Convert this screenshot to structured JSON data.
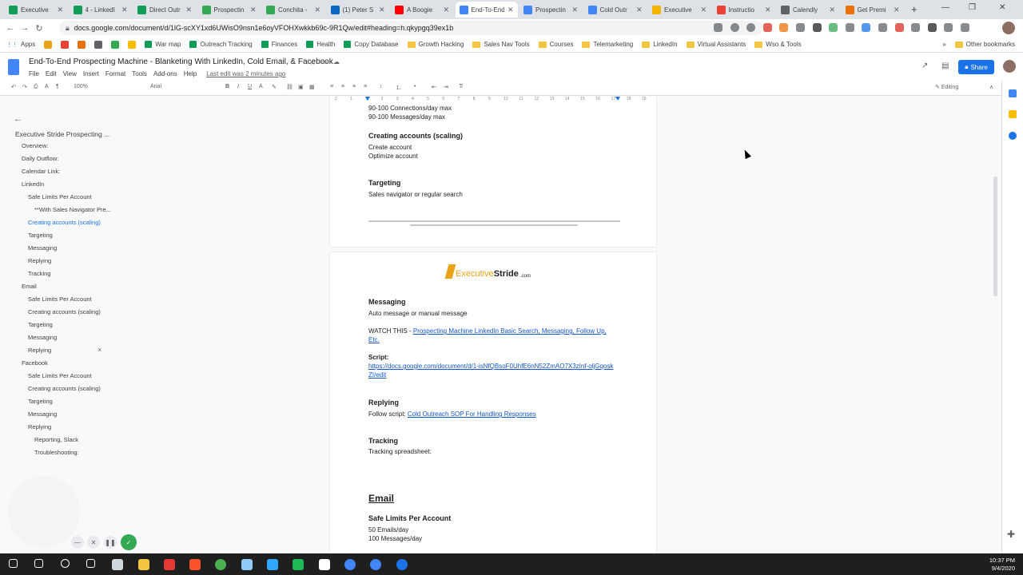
{
  "browser": {
    "tabs": [
      {
        "title": "Executive",
        "color": "#0f9d58"
      },
      {
        "title": "4 - LinkedI",
        "color": "#0f9d58"
      },
      {
        "title": "Direct Outr",
        "color": "#0f9d58"
      },
      {
        "title": "Prospectin",
        "color": "#34a853"
      },
      {
        "title": "Conchita -",
        "color": "#34a853"
      },
      {
        "title": "(1) Peter S",
        "color": "#0a66c2"
      },
      {
        "title": "A Boogie",
        "color": "#ff0000"
      },
      {
        "title": "End-To-End",
        "color": "#4285f4"
      },
      {
        "title": "Prospectin",
        "color": "#4285f4"
      },
      {
        "title": "Cold Outr",
        "color": "#4285f4"
      },
      {
        "title": "Executive",
        "color": "#f4b400"
      },
      {
        "title": "Instructio",
        "color": "#ea4335"
      },
      {
        "title": "Calendly",
        "color": "#5f6368"
      },
      {
        "title": "Get Premi",
        "color": "#e8710a"
      }
    ],
    "active_tab": 7,
    "url": "docs.google.com/document/d/1lG-scXY1xd6UWisO9nsn1e6oyVFOHXwkkb69c-9R1Qw/edit#heading=h.qkypgq39ex1b",
    "bookmarks": [
      {
        "label": "Apps",
        "kind": "apps"
      },
      {
        "label": "War map",
        "kind": "sheet"
      },
      {
        "label": "Outreach Tracking",
        "kind": "sheet"
      },
      {
        "label": "Finances",
        "kind": "sheet"
      },
      {
        "label": "Health",
        "kind": "sheet"
      },
      {
        "label": "Copy Database",
        "kind": "sheet"
      },
      {
        "label": "Growth Hacking",
        "kind": "folder"
      },
      {
        "label": "Sales Nav Tools",
        "kind": "folder"
      },
      {
        "label": "Courses",
        "kind": "folder"
      },
      {
        "label": "Telemarketing",
        "kind": "folder"
      },
      {
        "label": "LinkedIn",
        "kind": "folder"
      },
      {
        "label": "Virtual Assistants",
        "kind": "folder"
      },
      {
        "label": "Wso & Tools",
        "kind": "folder"
      }
    ],
    "other_bookmarks": "Other bookmarks",
    "more_glyph": "»"
  },
  "doc": {
    "title": "End-To-End Prospecting Machine - Blanketing With LinkedIn, Cold Email, & Facebook",
    "menus": [
      "File",
      "Edit",
      "View",
      "Insert",
      "Format",
      "Tools",
      "Add-ons",
      "Help"
    ],
    "last_edit": "Last edit was 2 minutes ago",
    "share": "Share",
    "zoom": "100%",
    "font": "Arial",
    "mode": "Editing"
  },
  "outline": {
    "title": "Executive Stride Prospecting ...",
    "items": [
      {
        "label": "Overview:",
        "level": 1,
        "active": false
      },
      {
        "label": "Daily Outflow:",
        "level": 1,
        "active": false
      },
      {
        "label": "Calendar Link:",
        "level": 1,
        "active": false
      },
      {
        "label": "LinkedIn",
        "level": 1,
        "active": false
      },
      {
        "label": "Safe Limits Per Account",
        "level": 2,
        "active": false
      },
      {
        "label": "**With Sales Navigator Pre...",
        "level": 3,
        "active": false
      },
      {
        "label": "Creating accounts (scaling)",
        "level": 2,
        "active": true
      },
      {
        "label": "Targeting",
        "level": 2,
        "active": false
      },
      {
        "label": "Messaging",
        "level": 2,
        "active": false
      },
      {
        "label": "Replying",
        "level": 2,
        "active": false
      },
      {
        "label": "Tracking",
        "level": 2,
        "active": false
      },
      {
        "label": "Email",
        "level": 1,
        "active": false
      },
      {
        "label": "Safe Limits Per Account",
        "level": 2,
        "active": false
      },
      {
        "label": "Creating accounts (scaling)",
        "level": 2,
        "active": false
      },
      {
        "label": "Targeting",
        "level": 2,
        "active": false
      },
      {
        "label": "Messaging",
        "level": 2,
        "active": false
      },
      {
        "label": "Replying",
        "level": 2,
        "active": false
      },
      {
        "label": "Facebook",
        "level": 1,
        "active": false
      },
      {
        "label": "Safe Limits Per Account",
        "level": 2,
        "active": false
      },
      {
        "label": "Creating accounts (scaling)",
        "level": 2,
        "active": false
      },
      {
        "label": "Targeting",
        "level": 2,
        "active": false
      },
      {
        "label": "Messaging",
        "level": 2,
        "active": false
      },
      {
        "label": "Replying",
        "level": 2,
        "active": false
      },
      {
        "label": "Reporting, Slack",
        "level": 3,
        "active": false
      },
      {
        "label": "Troubleshooting:",
        "level": 3,
        "active": false
      }
    ],
    "remove_glyph": "×"
  },
  "ruler": {
    "ticks": [
      "2",
      "1",
      "1",
      "2",
      "3",
      "4",
      "5",
      "6",
      "7",
      "8",
      "9",
      "10",
      "11",
      "12",
      "13",
      "14",
      "15",
      "16",
      "17",
      "18",
      "19"
    ]
  },
  "page1": {
    "connections": "90-100 Connections/day max",
    "messages": "90-100 Messages/day max",
    "h_creating": "Creating accounts (scaling)",
    "create": "Create account",
    "optimize": "Optimize account",
    "h_targeting": "Targeting",
    "targeting_text": "Sales navigator or regular search"
  },
  "page2": {
    "logo_text": "Executive",
    "logo_bold": "Stride",
    "logo_suffix": ".com",
    "h_messaging": "Messaging",
    "auto": "Auto message or manual message",
    "watch": "WATCH THIS - ",
    "watch_link_1": "Prospecting Machine LinkedIn Basic Search, Messaging, Follow Up,",
    "watch_link_2": "Etc.",
    "script_label": "Script:",
    "script_link_1": "https://docs.google.com/document/d/1-isNfQBsoF0UhfE6nN52ZmAO7X3zInf-oljGqosk",
    "script_link_2": "ZI/edit",
    "h_replying": "Replying",
    "follow": "Follow script: ",
    "follow_link": "Cold Outreach SOP For Handling Responses",
    "h_tracking": "Tracking",
    "tracking_text": "Tracking spreadsheet:",
    "h_email": "Email",
    "h_safe": "Safe Limits Per Account",
    "emails": "50 Emails/day",
    "messages": "100 Messages/day"
  },
  "taskbar": {
    "time": "10:37 PM",
    "date": "9/4/2020"
  }
}
